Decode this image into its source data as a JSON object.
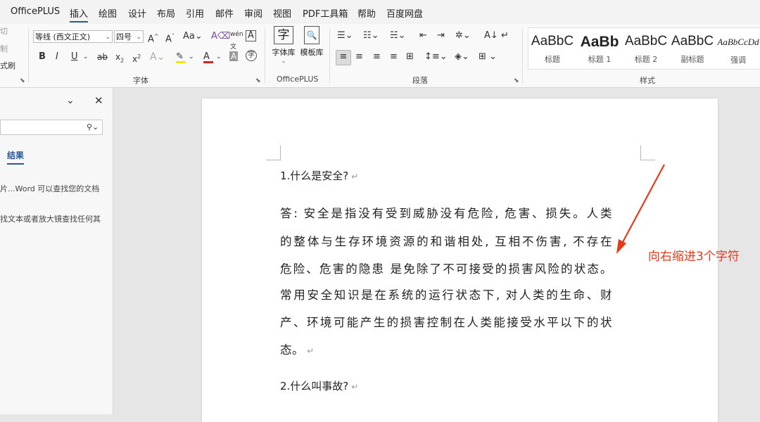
{
  "menu": {
    "tabs": [
      "OfficePLUS",
      "插入",
      "绘图",
      "设计",
      "布局",
      "引用",
      "邮件",
      "审阅",
      "视图",
      "PDF工具箱",
      "帮助",
      "百度网盘"
    ],
    "active_tab": "插入"
  },
  "ribbon": {
    "clipboard": {
      "cut": "切",
      "copy": "制",
      "format_painter": "式刷"
    },
    "font": {
      "font_name": "等线 (西文正文)",
      "font_size": "四号",
      "group_label": "字体"
    },
    "officeplus": {
      "char_lib": "字体库",
      "template_lib": "模板库",
      "group_label": "OfficePLUS"
    },
    "paragraph": {
      "group_label": "段落"
    },
    "styles": {
      "group_label": "样式",
      "items": [
        {
          "preview": "AaBbC",
          "label": "标题"
        },
        {
          "preview": "AaBb",
          "label": "标题 1"
        },
        {
          "preview": "AaBbC",
          "label": "标题 2"
        },
        {
          "preview": "AaBbC",
          "label": "副标题"
        },
        {
          "preview": "AaBbCcDd",
          "label": "强调"
        }
      ]
    }
  },
  "nav_pane": {
    "results_tab": "结果",
    "hint_line1": "片...Word 可以查找您的文档",
    "hint_line2": "找文本或者放大镜查找任何其"
  },
  "document": {
    "q1": "1.什么是安全?",
    "answer_lines": [
      "答: 安全是指没有受到威胁没有危险, 危害、损失。人类",
      "的整体与生存环境资源的和谐相处, 互相不伤害, 不存在",
      "危险、危害的隐患  是免除了不可接受的损害风险的状态。",
      "常用安全知识是在系统的运行状态下, 对人类的生命、财",
      "产、环境可能产生的损害控制在人类能接受水平以下的状",
      "态。"
    ],
    "q2": "2.什么叫事故?",
    "para_mark": "↵"
  },
  "annotation": {
    "text": "向右缩进3个字符",
    "color": "#e5391a"
  }
}
